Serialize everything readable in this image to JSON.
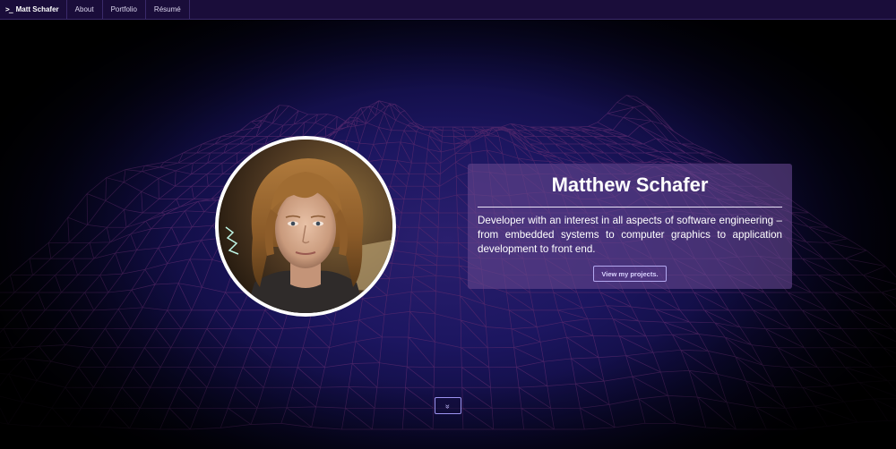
{
  "navbar": {
    "brand_icon": ">_",
    "brand_label": "Matt Schafer",
    "items": [
      {
        "label": "About"
      },
      {
        "label": "Portfolio"
      },
      {
        "label": "Résumé"
      }
    ]
  },
  "hero": {
    "name": "Matthew Schafer",
    "description": "Developer with an interest in all aspects of software engineering – from embedded systems to computer graphics to application development to front end.",
    "cta_label": "View my projects.",
    "scroll_icon": "double-chevron-down-icon",
    "scroll_glyph": "»"
  },
  "colors": {
    "navbar_bg": "#1a0d3a",
    "background": "#1c1660",
    "card_bg": "#64468c",
    "accent": "#b3a8f0",
    "mesh_line": "#5a2a6e"
  }
}
